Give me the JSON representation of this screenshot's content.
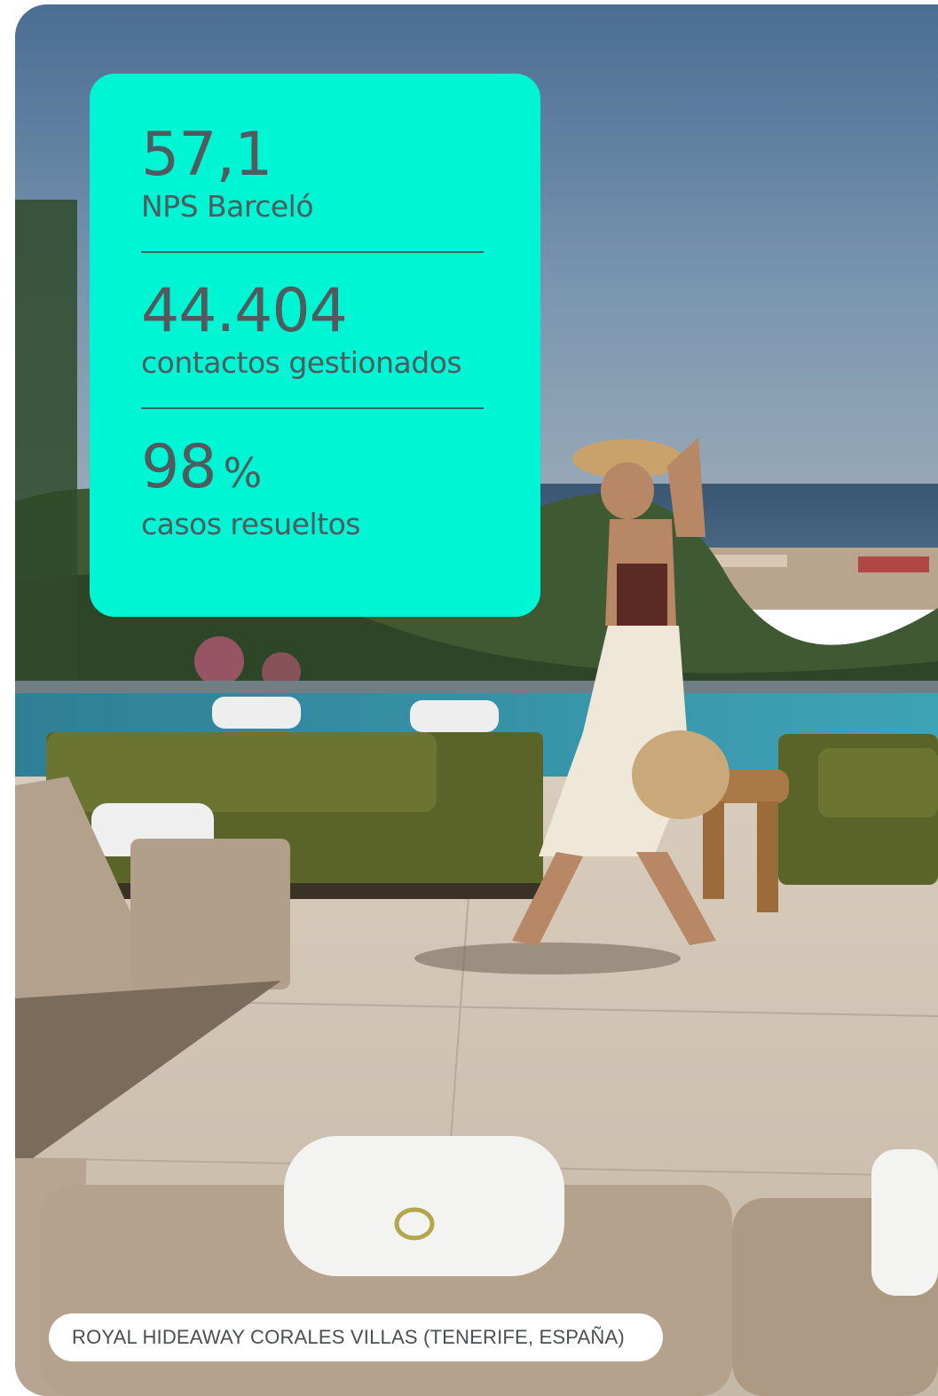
{
  "stats": [
    {
      "value": "57,1",
      "unit": "",
      "label": "NPS Barceló"
    },
    {
      "value": "44.404",
      "unit": "",
      "label": "contactos gestionados"
    },
    {
      "value": "98",
      "unit": "%",
      "label": "casos resueltos"
    }
  ],
  "caption": "ROYAL HIDEAWAY CORALES VILLAS (TENERIFE, ESPAÑA)",
  "colors": {
    "card_accent": "#00f5d4",
    "text": "#4f5b5d"
  },
  "photo": {
    "description_icon": "resort-pool-photo"
  }
}
